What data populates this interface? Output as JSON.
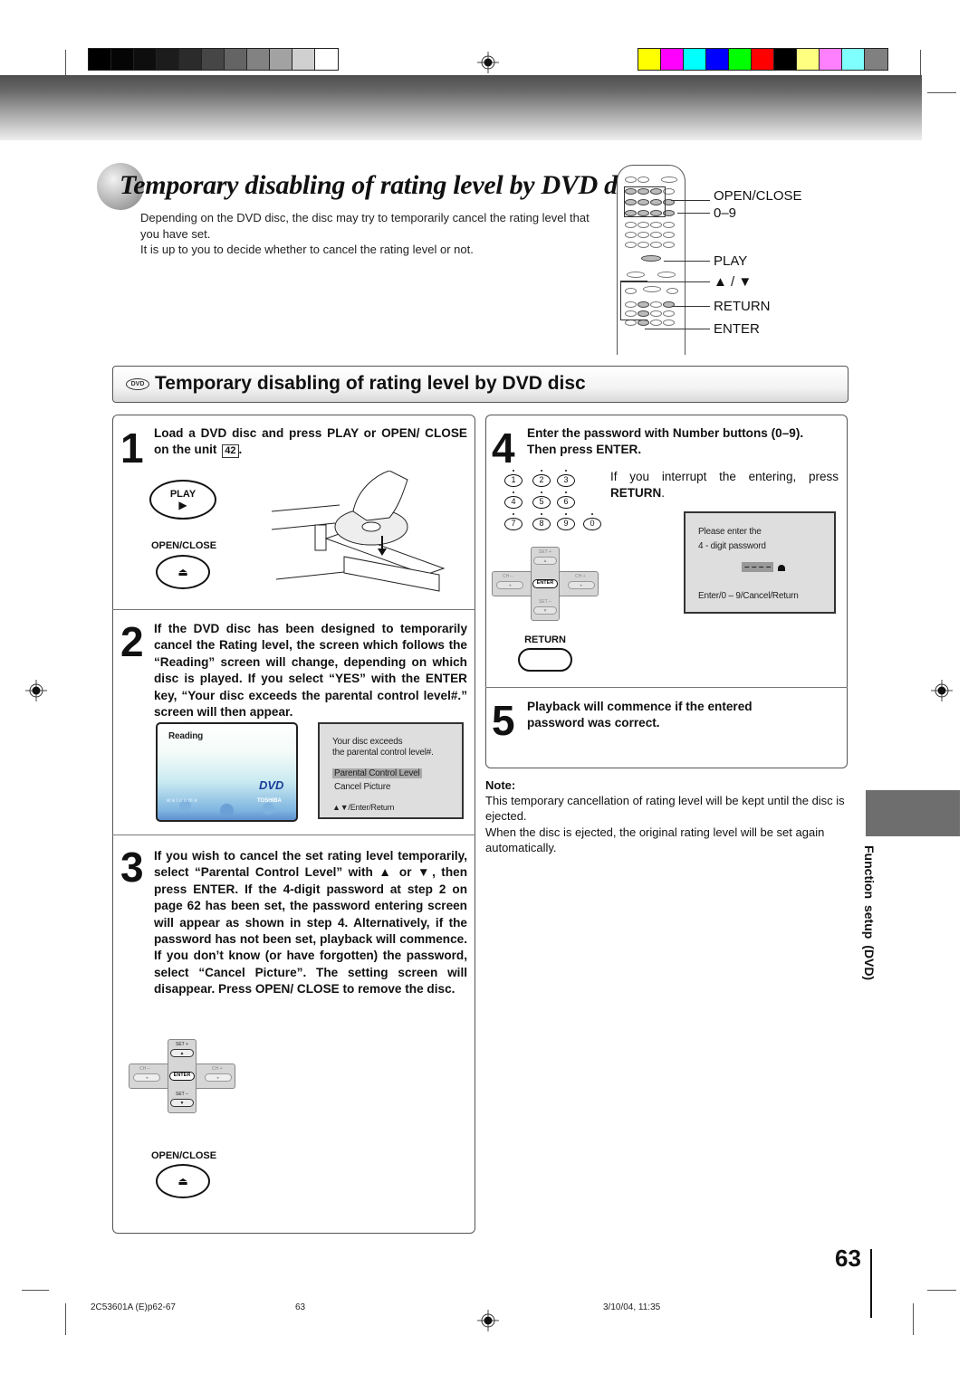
{
  "color_bars": {
    "grayscale": [
      "#000000",
      "#050505",
      "#0e0e0e",
      "#1c1c1c",
      "#2b2b2b",
      "#464646",
      "#646464",
      "#828282",
      "#a2a2a2",
      "#d0d0d0",
      "#ffffff"
    ],
    "colors": [
      "#ffff00",
      "#ff00ff",
      "#00ffff",
      "#0000ff",
      "#00ff00",
      "#ff0000",
      "#000000",
      "#ffff80",
      "#ff80ff",
      "#80ffff",
      "#808080"
    ]
  },
  "title": "Temporary disabling of rating level by DVD disc",
  "intro": {
    "line1": "Depending on the DVD disc, the disc may try to temporarily cancel the rating level that you have set.",
    "line2": "It is up to you to decide whether to cancel the rating level or not."
  },
  "remote_labels": {
    "open_close": "OPEN/CLOSE",
    "numbers": "0–9",
    "play": "PLAY",
    "up_down": "▲ / ▼",
    "return": "RETURN",
    "enter": "ENTER"
  },
  "section": {
    "logo": "DVD",
    "title": "Temporary disabling of rating level by DVD disc"
  },
  "steps": [
    {
      "number": "1",
      "text": "Load a DVD disc and press PLAY or OPEN/ CLOSE on the unit",
      "page_ref": "42",
      "buttons": {
        "play": "PLAY",
        "play_glyph": "▶",
        "open_close": "OPEN/CLOSE",
        "eject_glyph": "⏏"
      }
    },
    {
      "number": "2",
      "text": "If the DVD disc has been designed to temporarily cancel the Rating level, the screen which follows the “Reading” screen will change, depending on which disc is played. If you select “YES” with the ENTER key, “Your disc exceeds the parental control level#.” screen will then appear.",
      "reading_screen": {
        "label": "Reading",
        "welcome": "w e l c o m e",
        "brand": "TOSHIBA",
        "logo": "DVD"
      },
      "menu_screen": {
        "line1": "Your disc exceeds",
        "line2": "the parental control level#.",
        "option_selected": "Parental Control Level",
        "option2": "Cancel Picture",
        "hint": "▲▼/Enter/Return"
      }
    },
    {
      "number": "3",
      "text": "If you wish to cancel the set rating level temporarily, select “Parental Control Level” with ▲ or ▼, then press ENTER. If the 4-digit password at step 2 on page 62 has been set, the password entering screen will appear as shown in step 4. Alternatively, if the password has not been set, playback will commence. If you don’t know (or have forgotten) the password, select “Cancel Picture”. The setting screen will disappear. Press OPEN/ CLOSE to remove the disc.",
      "buttons": {
        "open_close": "OPEN/CLOSE",
        "eject_glyph": "⏏"
      }
    },
    {
      "number": "4",
      "text_line1": "Enter the password with Number buttons (0–9).",
      "text_line2": "Then press ENTER.",
      "hint_text": "If you interrupt the entering, press",
      "hint_bold": "RETURN",
      "hint_end": ".",
      "number_buttons": [
        "1",
        "2",
        "3",
        "4",
        "5",
        "6",
        "7",
        "8",
        "9",
        "0"
      ],
      "return_label": "RETURN",
      "password_screen": {
        "line1": "Please enter the",
        "line2": "4 - digit password",
        "field": "– – – –",
        "hint": "Enter/0 – 9/Cancel/Return"
      }
    },
    {
      "number": "5",
      "text": "Playback will commence if the entered password was correct."
    }
  ],
  "dpad": {
    "set_plus": "SET +",
    "set_minus": "SET –",
    "ch_minus": "CH –",
    "ch_plus": "CH +",
    "enter": "ENTER"
  },
  "note": {
    "heading": "Note:",
    "line1": "This temporary cancellation of rating level will be kept until the disc is ejected.",
    "line2": "When the disc is ejected, the original rating level will be set again automatically."
  },
  "side_label": "Function setup (DVD)",
  "page_number": "63",
  "footer": {
    "file": "2C53601A (E)p62-67",
    "page": "63",
    "date": "3/10/04, 11:35"
  }
}
